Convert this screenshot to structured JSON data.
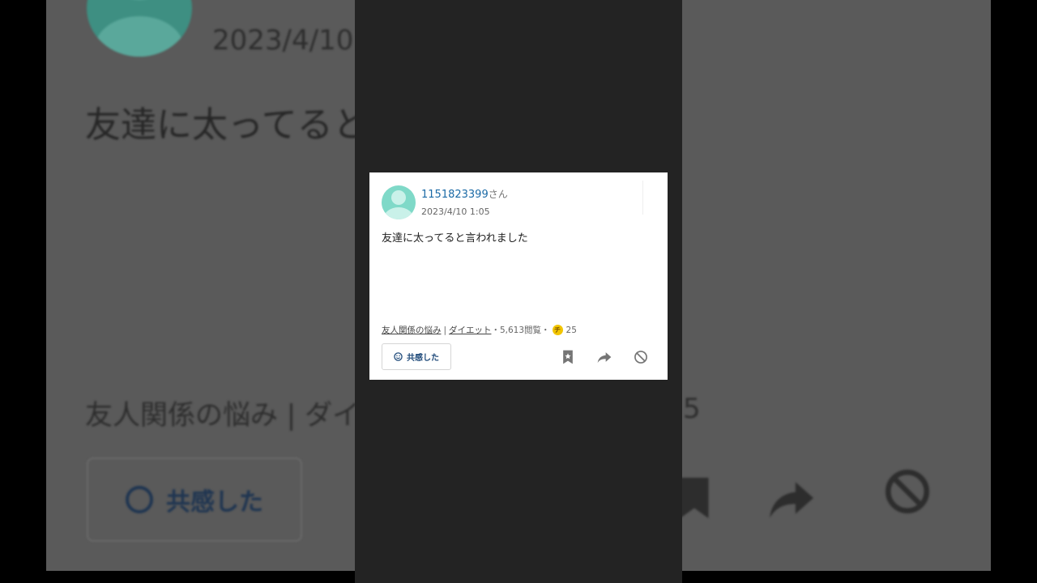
{
  "user": {
    "name": "1151823399",
    "suffix": "さん",
    "date": "2023/4/10 1:05"
  },
  "question": {
    "text": "友達に太ってると言われました"
  },
  "meta": {
    "category1": "友人関係の悩み",
    "divider": "|",
    "category2": "ダイエット",
    "dot1": "・",
    "views": "5,613閲覧",
    "dot2": "・",
    "coin_label": "チ",
    "coins": "25"
  },
  "actions": {
    "empathy_label": "共感した"
  },
  "background": {
    "date": "2023/4/10",
    "body": "友達に太ってると",
    "tags_partial": "友人関係の悩み | ダイ",
    "count_partial": "5",
    "empathy_label": "共感した"
  },
  "icons": [
    "user-avatar-icon",
    "smiley-icon",
    "bookmark-star-icon",
    "share-arrow-icon",
    "block-icon",
    "coin-icon"
  ],
  "colors": {
    "link": "#1b6aa6",
    "button_text": "#1f4a7a",
    "coin": "#f2c500",
    "avatar": "#7fd9c8"
  }
}
